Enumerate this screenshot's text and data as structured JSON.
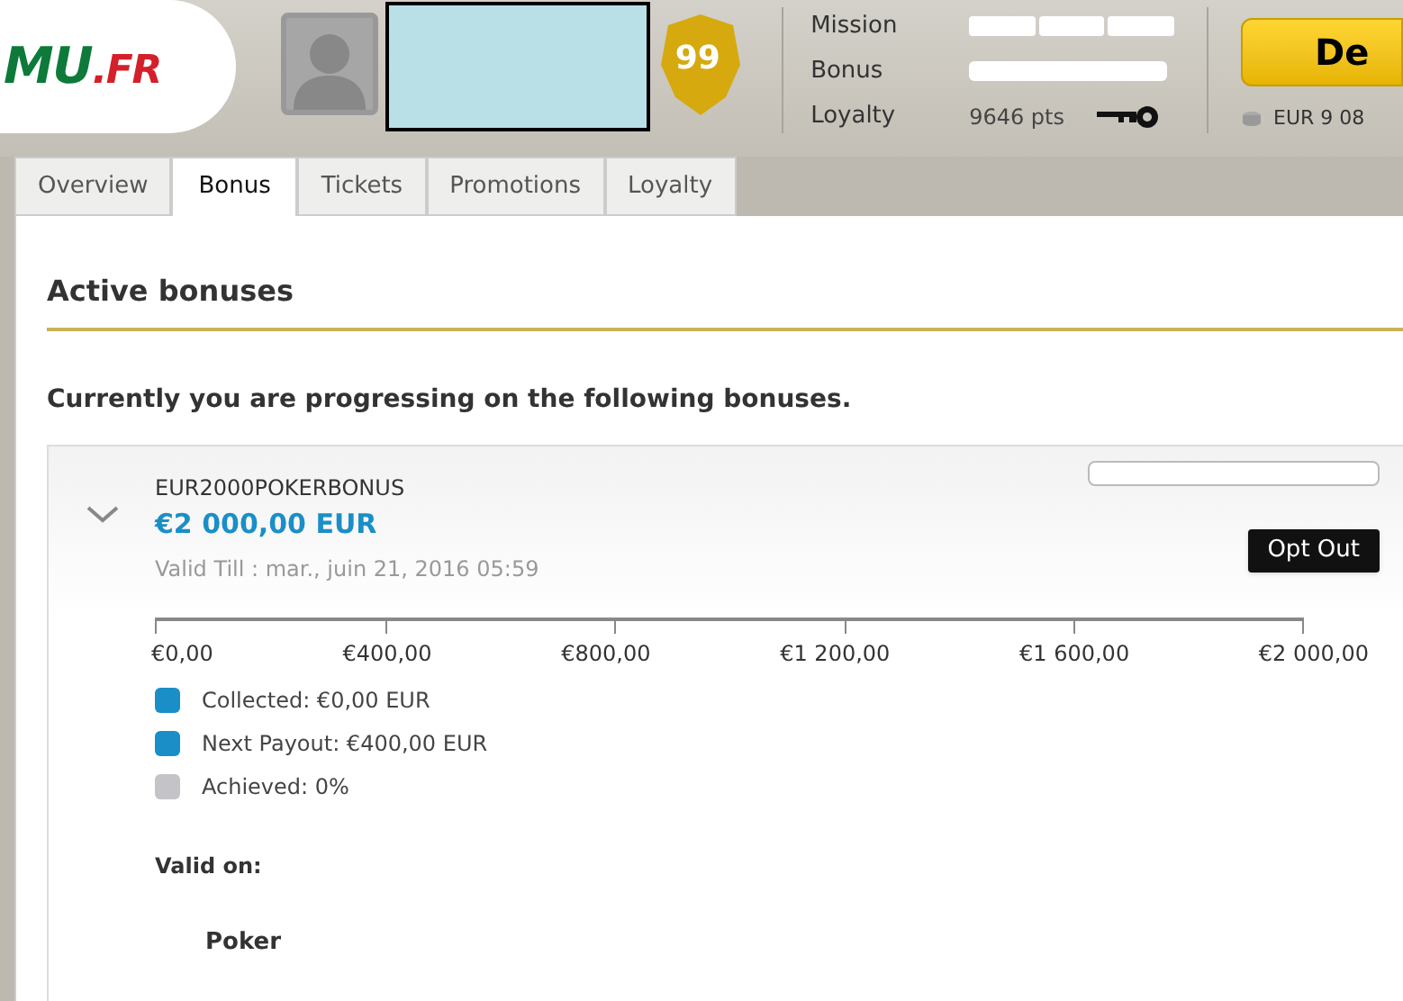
{
  "header": {
    "logo": {
      "main": "MU",
      "suffix": ".FR"
    },
    "level_badge": "99",
    "stats": [
      {
        "kind": "segments",
        "label": "Mission",
        "level": 0
      },
      {
        "kind": "bar",
        "label": "Bonus",
        "level": 0
      },
      {
        "kind": "points",
        "label": "Loyalty",
        "value": "9646 pts"
      }
    ],
    "deposit_button": "De",
    "balance": "EUR 9 08"
  },
  "tabs": [
    {
      "label": "Overview",
      "selected": false
    },
    {
      "label": "Bonus",
      "selected": true
    },
    {
      "label": "Tickets",
      "selected": false
    },
    {
      "label": "Promotions",
      "selected": false
    },
    {
      "label": "Loyalty",
      "selected": false
    }
  ],
  "section_title": "Active bonuses",
  "intro": "Currently you are progressing on the following bonuses.",
  "bonus": {
    "code": "EUR2000POKERBONUS",
    "amount": "€2 000,00 EUR",
    "valid_till": "Valid Till : mar., juin 21, 2016 05:59",
    "opt_out": "Opt Out",
    "expanded": false,
    "progress": {
      "ticks": [
        "€0,00",
        "€400,00",
        "€800,00",
        "€1 200,00",
        "€1 600,00",
        "€2 000,00"
      ]
    },
    "legend": [
      {
        "label": "Collected: €0,00 EUR",
        "color": "#1a8fc7"
      },
      {
        "label": "Next Payout: €400,00 EUR",
        "color": "#1a8fc7"
      },
      {
        "label": "Achieved: 0%",
        "color": "#c4c3c8"
      }
    ],
    "valid_on_label": "Valid on:",
    "valid_on": [
      "Poker"
    ]
  }
}
